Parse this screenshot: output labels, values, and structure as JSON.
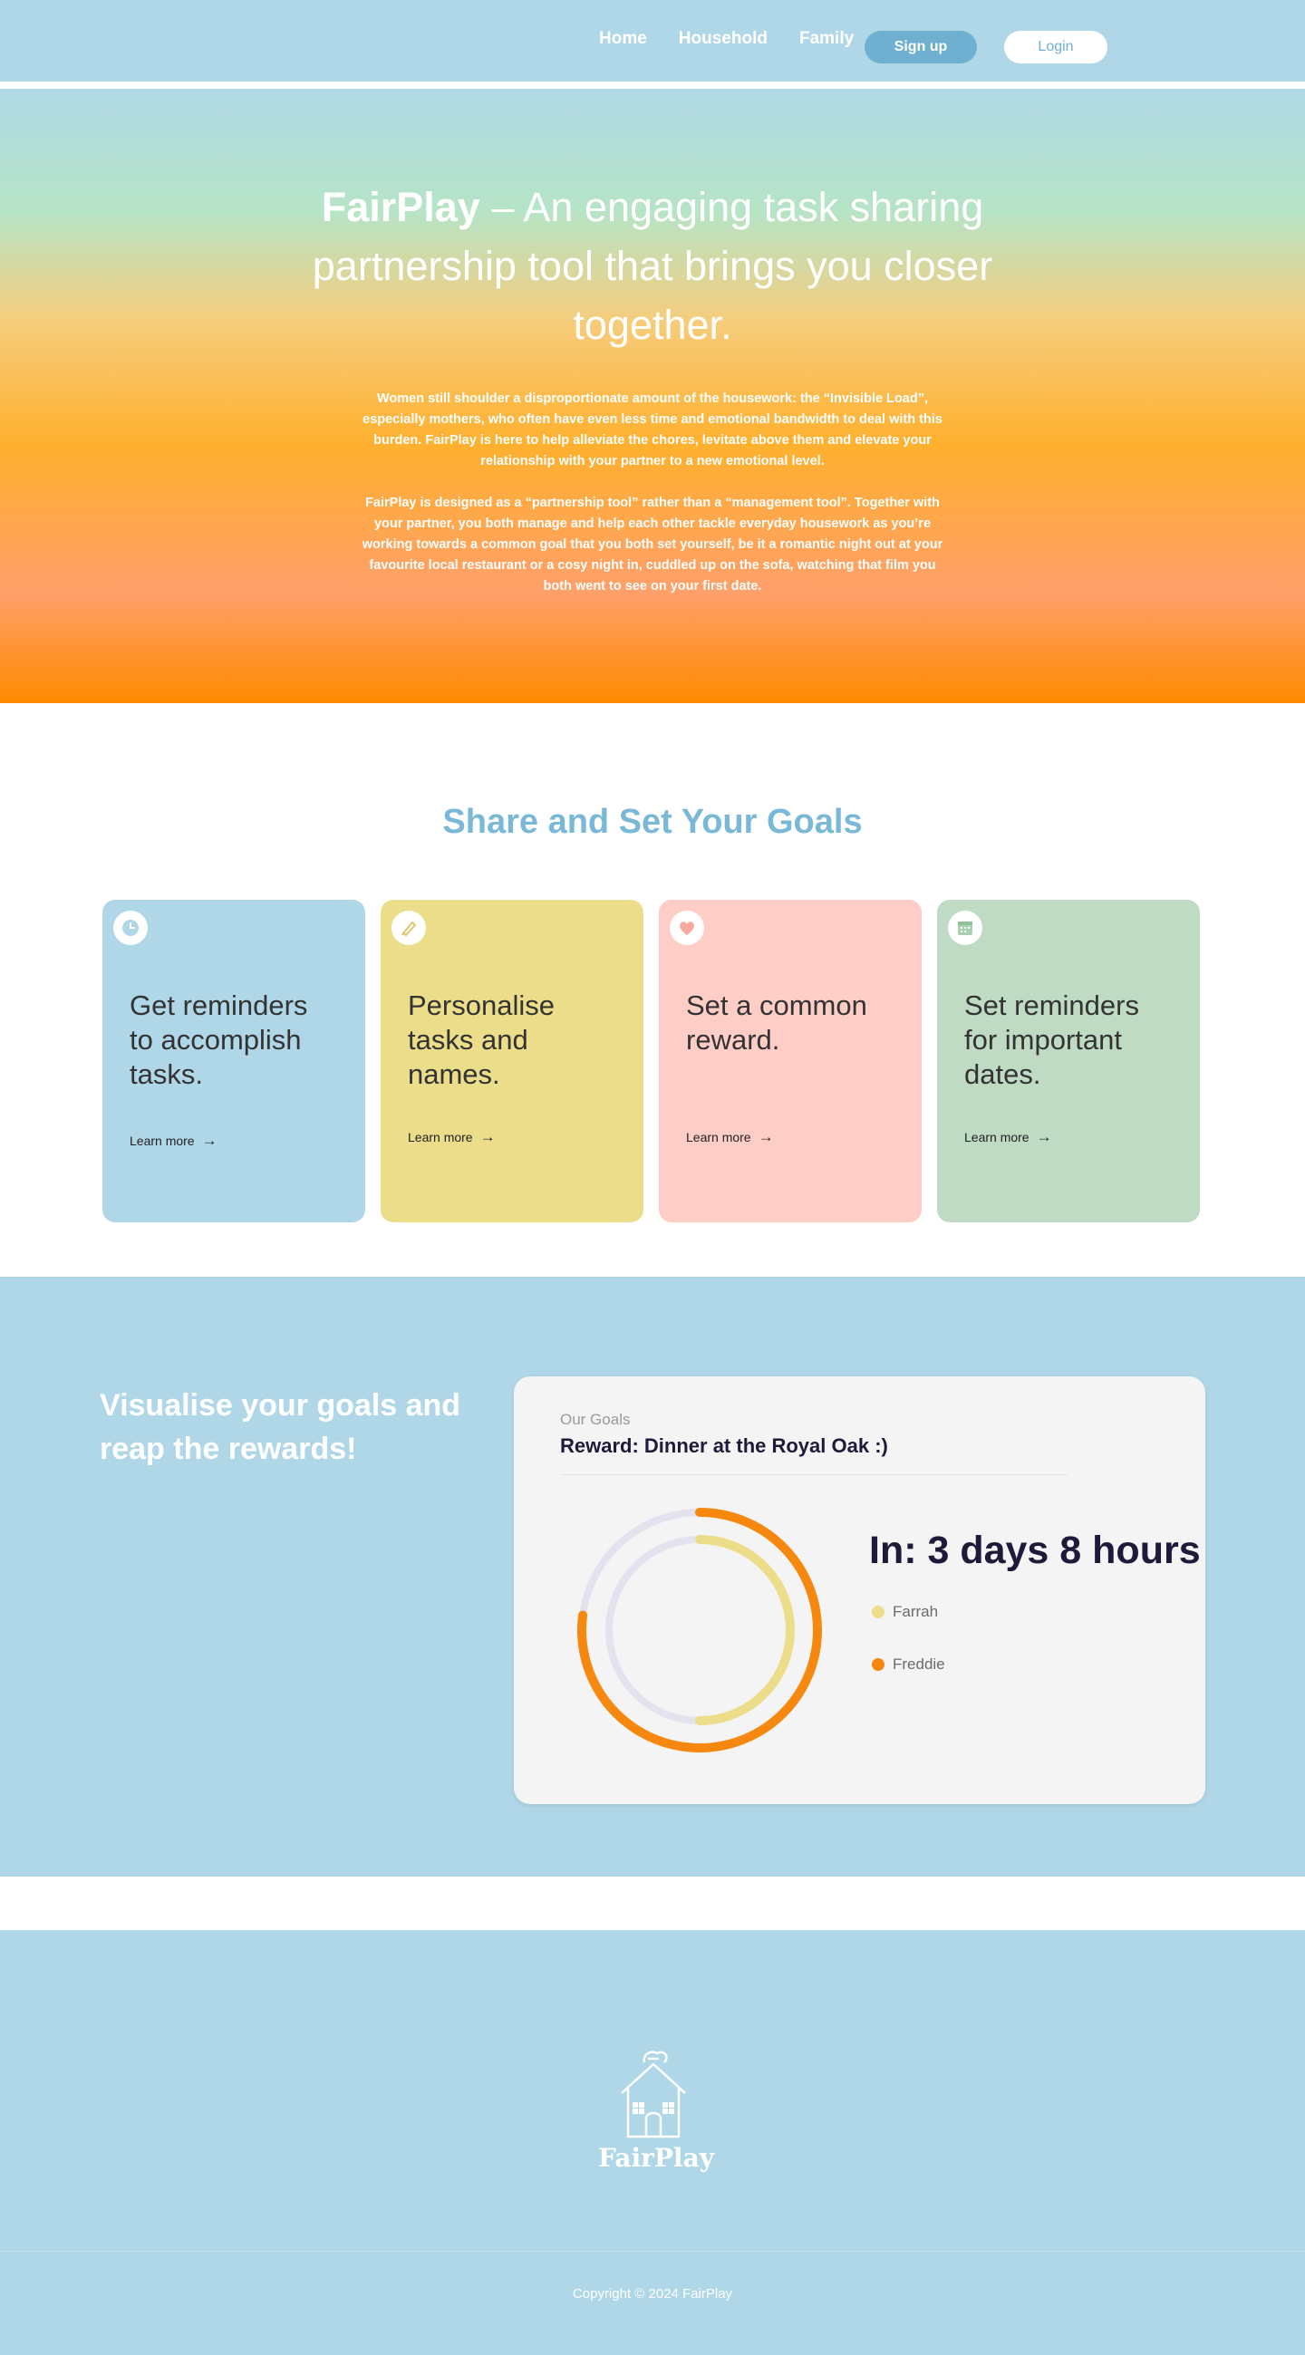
{
  "nav": {
    "links": [
      "Home",
      "Household",
      "Family"
    ],
    "signup_label": "Sign up",
    "login_label": "Login"
  },
  "hero": {
    "brand": "FairPlay",
    "headline_rest": " – An engaging task sharing partnership tool that brings you closer together.",
    "paragraph1": "Women still shoulder a disproportionate amount of the housework: the “Invisible Load”, especially mothers, who often have even less time and emotional bandwidth to deal with this burden. FairPlay is here to help alleviate the chores, levitate above them and elevate your relationship with your partner to a new emotional level.",
    "paragraph2": "FairPlay is designed as a “partnership tool” rather than a “management tool”.  Together with your partner, you both manage and help each other tackle everyday housework as you’re working towards a common goal that you both set yourself, be it a romantic night out at your favourite local restaurant or a cosy night in, cuddled up on the sofa, watching that film you both went to see on your first date."
  },
  "goals": {
    "title": "Share and Set Your Goals",
    "cards": [
      {
        "title": "Get reminders to accomplish tasks.",
        "link": "Learn more",
        "icon": "clock-icon",
        "color": "#b0d7e8"
      },
      {
        "title": "Personalise tasks and names.",
        "link": "Learn more",
        "icon": "pen-icon",
        "color": "#ecdd8a"
      },
      {
        "title": "Set a common reward.",
        "link": "Learn more",
        "icon": "heart-icon",
        "color": "#fecdc6"
      },
      {
        "title": "Set reminders for important dates.",
        "link": "Learn more",
        "icon": "calendar-icon",
        "color": "#bfdbc3"
      }
    ]
  },
  "visual": {
    "heading": "Visualise your goals and reap the rewards!",
    "card": {
      "label": "Our Goals",
      "reward": "Reward: Dinner at the Royal Oak :)",
      "countdown": "In: 3 days 8 hours",
      "legend": [
        {
          "name": "Farrah",
          "color": "#ecdd8a",
          "progress": 0.5
        },
        {
          "name": "Freddie",
          "color": "#f6870f",
          "progress": 0.77
        }
      ]
    }
  },
  "footer": {
    "logo_text": "FairPlay",
    "copyright": "Copyright © 2024 FairPlay"
  }
}
